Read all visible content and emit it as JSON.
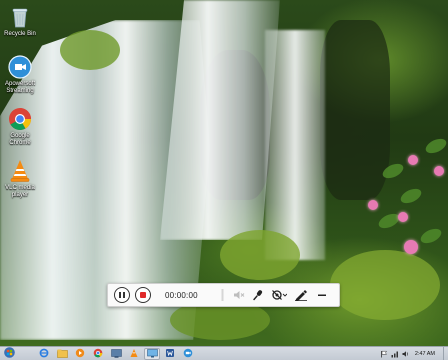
{
  "desktop": {
    "icons": [
      {
        "label": "Recycle Bin",
        "icon": "recycle-bin-icon"
      },
      {
        "label": "Apowersoft Streaming",
        "icon": "apowersoft-icon"
      },
      {
        "label": "Google Chrome",
        "icon": "chrome-icon"
      },
      {
        "label": "VLC media player",
        "icon": "vlc-icon"
      }
    ]
  },
  "recorder": {
    "time": "00:00:00",
    "pause_icon": "pause-icon",
    "stop_icon": "stop-record-icon",
    "tools": [
      "speaker-mute-icon",
      "microphone-icon",
      "webcam-off-icon",
      "pen-draw-icon",
      "minimize-icon"
    ],
    "stop_color": "#e02a2a"
  },
  "taskbar": {
    "items": [
      "windows-start-icon",
      "ie-icon",
      "file-explorer-icon",
      "media-player-icon",
      "chrome-icon",
      "recorder-app-icon",
      "vlc-icon",
      "monitor-icon",
      "word-icon",
      "apowersoft-icon"
    ],
    "clock": "2:47 AM"
  }
}
